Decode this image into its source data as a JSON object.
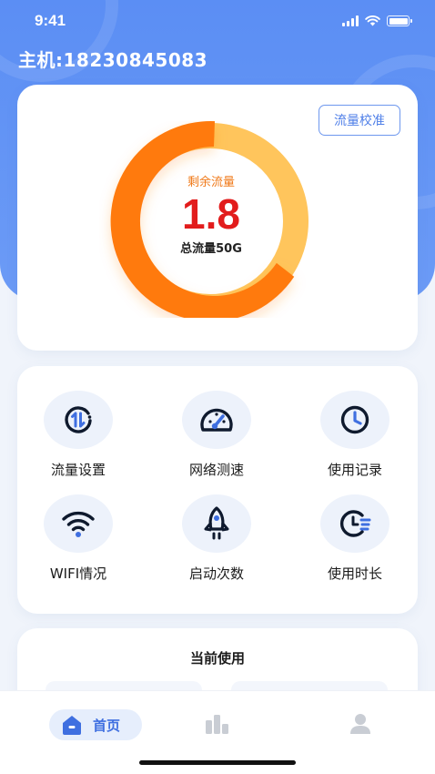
{
  "status_bar": {
    "time": "9:41"
  },
  "header": {
    "host_label": "主机:18230845083"
  },
  "traffic": {
    "calibrate_label": "流量校准",
    "remaining_label": "剩余流量",
    "remaining_value": "1.8",
    "total_label": "总流量50G"
  },
  "features": [
    {
      "label": "流量设置",
      "icon": "traffic-setting-icon"
    },
    {
      "label": "网络测速",
      "icon": "speedometer-icon"
    },
    {
      "label": "使用记录",
      "icon": "clock-icon"
    },
    {
      "label": "WIFI情况",
      "icon": "wifi-icon"
    },
    {
      "label": "启动次数",
      "icon": "rocket-icon"
    },
    {
      "label": "使用时长",
      "icon": "usage-time-icon"
    }
  ],
  "usage": {
    "title": "当前使用"
  },
  "tabbar": {
    "home_label": "首页",
    "items": [
      "home-icon",
      "bar-chart-icon",
      "user-icon"
    ]
  },
  "colors": {
    "primary": "#5b8ef4",
    "orange": "#ff7a08",
    "orange_light": "#ffc55c",
    "red_value": "#e21c1c",
    "icon_dark": "#0f1a2e",
    "icon_accent": "#3f6fe0"
  }
}
